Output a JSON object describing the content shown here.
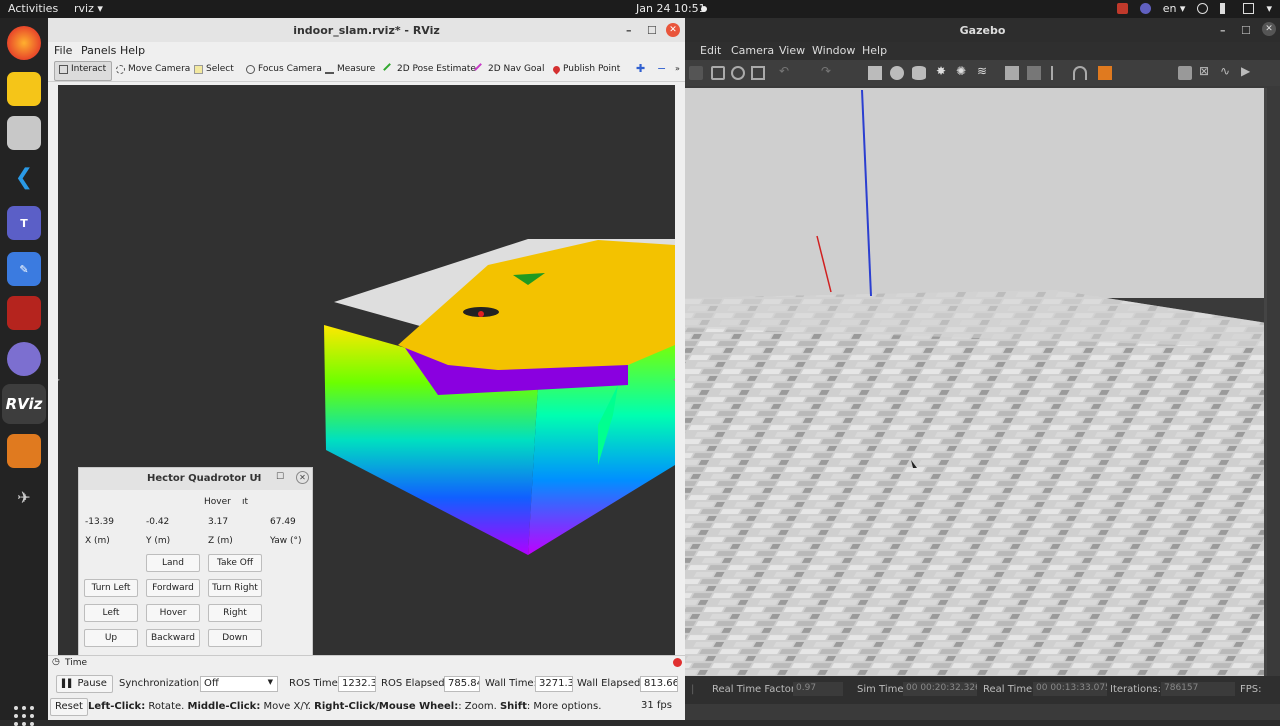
{
  "topbar": {
    "activities": "Activities",
    "app_menu": "rviz",
    "clock": "Jan 24  10:51",
    "language": "en"
  },
  "rviz": {
    "title": "indoor_slam.rviz* - RViz",
    "menu": [
      "File",
      "Panels",
      "Help"
    ],
    "tools": [
      "Interact",
      "Move Camera",
      "Select",
      "Focus Camera",
      "Measure",
      "2D Pose Estimate",
      "2D Nav Goal",
      "Publish Point"
    ],
    "tool_colors": {
      "pose": "#31a82e",
      "nav": "#c83cc8",
      "point": "#d43030"
    }
  },
  "hector": {
    "title": "Hector Quadrotor UI",
    "mode": "Hover",
    "mode_suffix": "ıt",
    "values": [
      "-13.39",
      "-0.42",
      "3.17",
      "67.49"
    ],
    "labels": [
      "X (m)",
      "Y (m)",
      "Z (m)",
      "Yaw (°)"
    ],
    "buttons": {
      "land": "Land",
      "take_off": "Take Off",
      "turn_left": "Turn Left",
      "forward": "Fordward",
      "turn_right": "Turn Right",
      "left": "Left",
      "hover": "Hover",
      "right": "Right",
      "up": "Up",
      "backward": "Backward",
      "down": "Down"
    }
  },
  "time_panel": {
    "title": "Time",
    "pause": "Pause",
    "sync_label": "Synchronization:",
    "sync_value": "Off",
    "ros_time_label": "ROS Time:",
    "ros_time": "1232.31",
    "ros_elapsed_label": "ROS Elapsed:",
    "ros_elapsed": "785.84",
    "wall_time_label": "Wall Time:",
    "wall_time": "3271.34",
    "wall_elapsed_label": "Wall Elapsed:",
    "wall_elapsed": "813.66",
    "reset": "Reset",
    "hint_left_b": "Left-Click:",
    "hint_left": " Rotate. ",
    "hint_mid_b": "Middle-Click:",
    "hint_mid": " Move X/Y. ",
    "hint_right_b": "Right-Click/Mouse Wheel:",
    "hint_right": ": Zoom. ",
    "hint_shift_b": "Shift",
    "hint_shift": ": More options.",
    "fps": "31 fps"
  },
  "gazebo": {
    "title": "Gazebo",
    "menu": [
      "Edit",
      "Camera",
      "View",
      "Window",
      "Help"
    ],
    "rtf_label": "Real Time Factor:",
    "rtf": "0.97",
    "sim_label": "Sim Time:",
    "sim": "00 00:20:32.326",
    "real_label": "Real Time:",
    "real": "00 00:13:33.075",
    "iter_label": "Iterations:",
    "iter": "786157",
    "fps_label": "FPS:"
  }
}
